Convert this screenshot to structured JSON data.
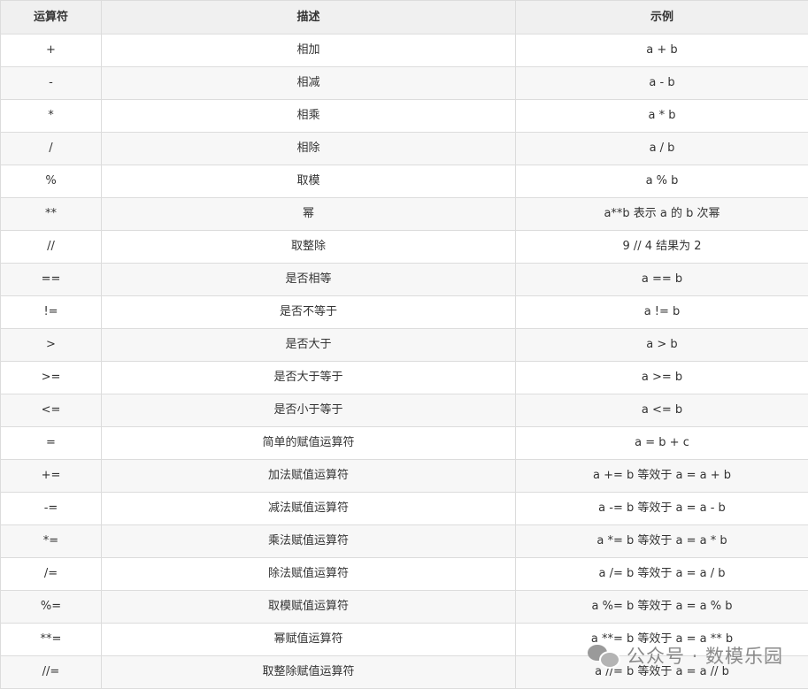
{
  "table": {
    "headers": [
      "运算符",
      "描述",
      "示例"
    ],
    "rows": [
      [
        "+",
        "相加",
        "a + b"
      ],
      [
        "-",
        "相减",
        "a - b"
      ],
      [
        "*",
        "相乘",
        "a * b"
      ],
      [
        "/",
        "相除",
        "a / b"
      ],
      [
        "%",
        "取模",
        "a % b"
      ],
      [
        "**",
        "幂",
        "a**b 表示 a 的 b 次幂"
      ],
      [
        "//",
        "取整除",
        "9 // 4 结果为 2"
      ],
      [
        "==",
        "是否相等",
        "a == b"
      ],
      [
        "!=",
        "是否不等于",
        "a != b"
      ],
      [
        ">",
        "是否大于",
        "a > b"
      ],
      [
        ">=",
        "是否大于等于",
        "a >= b"
      ],
      [
        "<=",
        "是否小于等于",
        "a <= b"
      ],
      [
        "=",
        "简单的赋值运算符",
        "a = b + c"
      ],
      [
        "+=",
        "加法赋值运算符",
        "a += b 等效于 a = a + b"
      ],
      [
        "-=",
        "减法赋值运算符",
        "a -= b 等效于 a = a - b"
      ],
      [
        "*=",
        "乘法赋值运算符",
        "a *= b 等效于 a = a * b"
      ],
      [
        "/=",
        "除法赋值运算符",
        "a /= b 等效于 a = a / b"
      ],
      [
        "%=",
        "取模赋值运算符",
        "a %= b 等效于 a = a % b"
      ],
      [
        "**=",
        "幂赋值运算符",
        "a **= b 等效于 a = a ** b"
      ],
      [
        "//=",
        "取整除赋值运算符",
        "a //= b 等效于 a = a // b"
      ]
    ]
  },
  "watermark": {
    "text": "公众号 · 数模乐园",
    "icon": "wechat-icon"
  }
}
